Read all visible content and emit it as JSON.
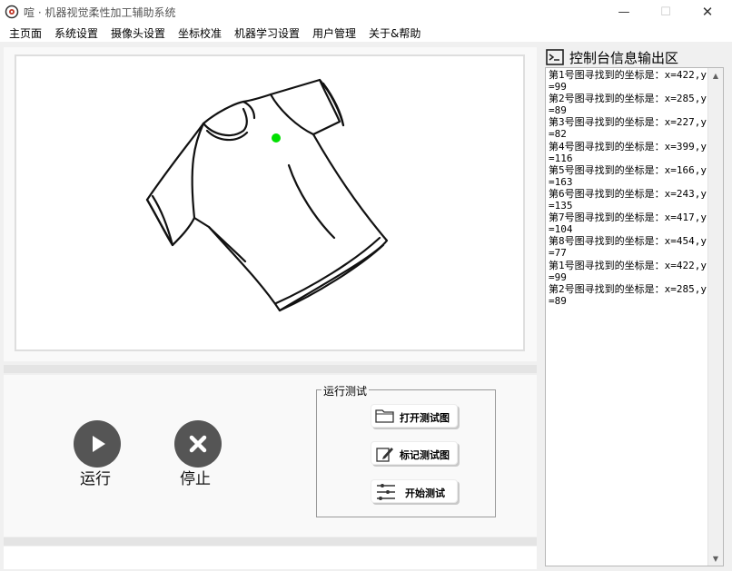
{
  "window": {
    "title": "喧 · 机器视觉柔性加工辅助系统",
    "controls": {
      "minimize": "—",
      "maximize": "☐",
      "close": "✕"
    }
  },
  "menu": [
    {
      "id": "home",
      "label": "主页面"
    },
    {
      "id": "system",
      "label": "系统设置"
    },
    {
      "id": "camera",
      "label": "摄像头设置"
    },
    {
      "id": "calib",
      "label": "坐标校准"
    },
    {
      "id": "ml",
      "label": "机器学习设置"
    },
    {
      "id": "users",
      "label": "用户管理"
    },
    {
      "id": "about",
      "label": "关于&帮助"
    }
  ],
  "image_view": {
    "subject": "t-shirt-outline",
    "marker_color": "#00e000"
  },
  "controls": {
    "run_label": "运行",
    "stop_label": "停止"
  },
  "test_group": {
    "title": "运行测试",
    "buttons": [
      {
        "id": "open",
        "label": "打开测试图",
        "icon": "folder-icon"
      },
      {
        "id": "mark",
        "label": "标记测试图",
        "icon": "edit-icon"
      },
      {
        "id": "start",
        "label": "开始测试",
        "icon": "sliders-icon"
      }
    ]
  },
  "console": {
    "title": "控制台信息输出区",
    "log": "第1号图寻找到的坐标是：x=422,y=99\n第2号图寻找到的坐标是：x=285,y=89\n第3号图寻找到的坐标是：x=227,y=82\n第4号图寻找到的坐标是：x=399,y=116\n第5号图寻找到的坐标是：x=166,y=163\n第6号图寻找到的坐标是：x=243,y=135\n第7号图寻找到的坐标是：x=417,y=104\n第8号图寻找到的坐标是：x=454,y=77\n第1号图寻找到的坐标是：x=422,y=99\n第2号图寻找到的坐标是：x=285,y=89"
  }
}
